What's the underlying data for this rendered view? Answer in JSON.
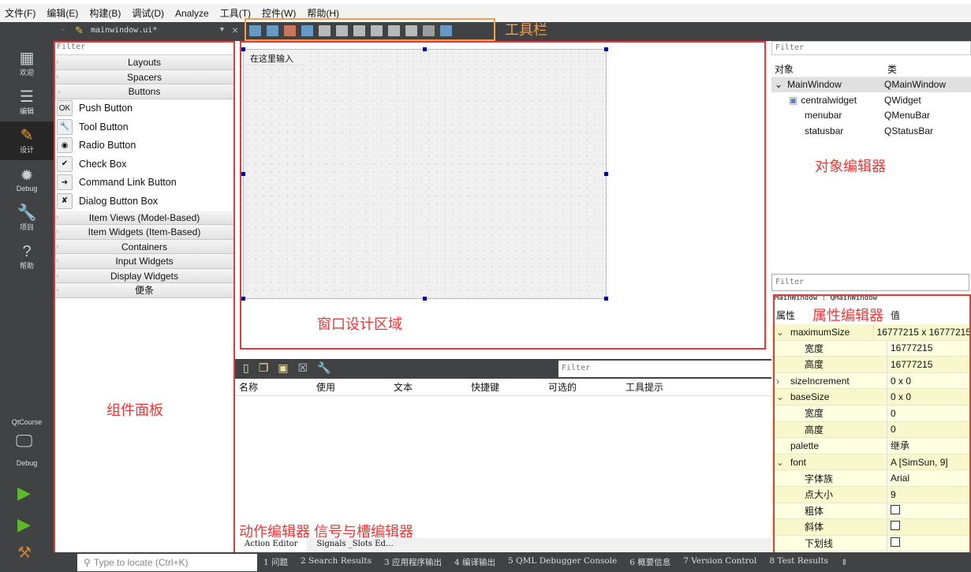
{
  "menu": [
    "文件(F)",
    "编辑(E)",
    "构建(B)",
    "调试(D)",
    "Analyze",
    "工具(T)",
    "控件(W)",
    "帮助(H)"
  ],
  "editor_tab": {
    "filename": "mainwindow.ui*"
  },
  "toolbar_icons": [
    "edit-widgets-icon",
    "edit-signals-icon",
    "edit-buddies-icon",
    "edit-tab-order-icon",
    "layout-horizontal-icon",
    "layout-vertical-icon",
    "layout-h-splitter-icon",
    "layout-v-splitter-icon",
    "layout-form-icon",
    "layout-grid-icon",
    "break-layout-icon",
    "adjust-size-icon"
  ],
  "modes": [
    {
      "label": "欢迎",
      "icon": "▦"
    },
    {
      "label": "编辑",
      "icon": "☰"
    },
    {
      "label": "设计",
      "icon": "✎"
    },
    {
      "label": "Debug",
      "icon": "✹"
    },
    {
      "label": "项目",
      "icon": "🔧"
    },
    {
      "label": "帮助",
      "icon": "?"
    }
  ],
  "kit": {
    "project": "QtCourse",
    "build": "Debug"
  },
  "annotations": {
    "toolbar": "工具栏",
    "widget_box": "组件面板",
    "design_area": "窗口设计区域",
    "object_inspector": "对象编辑器",
    "property_editor": "属性编辑器",
    "action_signal": "动作编辑器 信号与槽编辑器"
  },
  "widget_box": {
    "filter": "Filter",
    "cats_top": [
      "Layouts",
      "Spacers",
      "Buttons"
    ],
    "buttons": [
      {
        "label": "Push Button",
        "icon": "OK"
      },
      {
        "label": "Tool Button",
        "icon": "🔧"
      },
      {
        "label": "Radio Button",
        "icon": "◉"
      },
      {
        "label": "Check Box",
        "icon": "✔"
      },
      {
        "label": "Command Link Button",
        "icon": "➔"
      },
      {
        "label": "Dialog Button Box",
        "icon": "✘"
      }
    ],
    "cats_bottom": [
      "Item Views (Model-Based)",
      "Item Widgets (Item-Based)",
      "Containers",
      "Input Widgets",
      "Display Widgets",
      "便条"
    ]
  },
  "form": {
    "menu_placeholder": "在这里输入"
  },
  "action_editor": {
    "filter": "Filter",
    "columns": [
      "名称",
      "使用",
      "文本",
      "快捷键",
      "可选的",
      "工具提示"
    ],
    "tabs": [
      "Action Editor",
      "Signals _Slots Ed…"
    ]
  },
  "object_inspector": {
    "filter": "Filter",
    "col_object": "对象",
    "col_class": "类",
    "rows": [
      {
        "name": "MainWindow",
        "cls": "QMainWindow"
      },
      {
        "name": "centralwidget",
        "cls": "QWidget"
      },
      {
        "name": "menubar",
        "cls": "QMenuBar"
      },
      {
        "name": "statusbar",
        "cls": "QStatusBar"
      }
    ]
  },
  "property_editor": {
    "filter": "Filter",
    "context": "MainWindow : QMainWindow",
    "col_prop": "属性",
    "col_value": "值",
    "rows": [
      {
        "k": "maximumSize",
        "v": "16777215 x 16777215",
        "lvl": 0,
        "exp": "⌄"
      },
      {
        "k": "宽度",
        "v": "16777215",
        "lvl": 1
      },
      {
        "k": "高度",
        "v": "16777215",
        "lvl": 1
      },
      {
        "k": "sizeIncrement",
        "v": "0 x 0",
        "lvl": 0,
        "exp": "›"
      },
      {
        "k": "baseSize",
        "v": "0 x 0",
        "lvl": 0,
        "exp": "⌄"
      },
      {
        "k": "宽度",
        "v": "0",
        "lvl": 1
      },
      {
        "k": "高度",
        "v": "0",
        "lvl": 1
      },
      {
        "k": "palette",
        "v": "继承",
        "lvl": 0
      },
      {
        "k": "font",
        "v": "A  [SimSun, 9]",
        "lvl": 0,
        "exp": "⌄"
      },
      {
        "k": "字体族",
        "v": "Arial",
        "lvl": 1
      },
      {
        "k": "点大小",
        "v": "9",
        "lvl": 1
      },
      {
        "k": "粗体",
        "v": "",
        "cb": true,
        "lvl": 1
      },
      {
        "k": "斜体",
        "v": "",
        "cb": true,
        "lvl": 1
      },
      {
        "k": "下划线",
        "v": "",
        "cb": true,
        "lvl": 1
      }
    ]
  },
  "statusbar": {
    "locate_placeholder": "Type to locate (Ctrl+K)",
    "panes": [
      "1 问题",
      "2 Search Results",
      "3 应用程序输出",
      "4 编译输出",
      "5 QML Debugger Console",
      "6 概要信息",
      "7 Version Control",
      "8 Test Results"
    ]
  }
}
